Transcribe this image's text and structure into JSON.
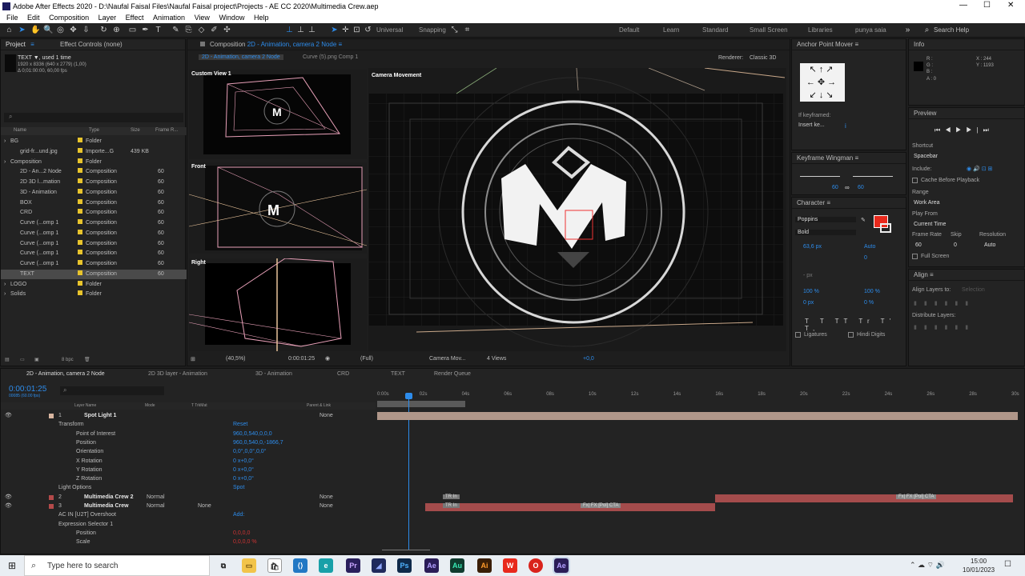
{
  "window": {
    "title": "Adobe After Effects 2020 - D:\\Naufal Faisal Files\\Naufal Faisal project\\Projects - AE CC 2020\\Multimedia Crew.aep"
  },
  "menu": [
    "File",
    "Edit",
    "Composition",
    "Layer",
    "Effect",
    "Animation",
    "View",
    "Window",
    "Help"
  ],
  "toolbar": {
    "universal": "Universal",
    "snapping": "Snapping"
  },
  "workspaces": [
    "Default",
    "Learn",
    "Standard",
    "Small Screen",
    "Libraries",
    "punya saia"
  ],
  "search_help": "Search Help",
  "project": {
    "tab_project": "Project",
    "tab_effects": "Effect Controls (none)",
    "item_name": "TEXT ▼, used 1 time",
    "item_dims": "1920 x 8336 (640 x 2779) (1,00)",
    "item_dur": "Δ 0;01:00:00, 60,00 fps",
    "cols": [
      "Name",
      "Type",
      "Size",
      "Frame R..."
    ],
    "items": [
      {
        "name": "BG",
        "type": "Folder",
        "size": "",
        "fr": "",
        "indent": 0,
        "color": "#e8c42c"
      },
      {
        "name": "grid-fr...und.jpg",
        "type": "Importe...G",
        "size": "439 KB",
        "fr": "",
        "indent": 1,
        "color": "#e8c42c"
      },
      {
        "name": "Composition",
        "type": "Folder",
        "size": "",
        "fr": "",
        "indent": 0,
        "color": "#e8c42c"
      },
      {
        "name": "2D - An...2 Node",
        "type": "Composition",
        "size": "",
        "fr": "60",
        "indent": 1,
        "color": "#e8c42c"
      },
      {
        "name": "2D 3D l...mation",
        "type": "Composition",
        "size": "",
        "fr": "60",
        "indent": 1,
        "color": "#e8c42c"
      },
      {
        "name": "3D - Animation",
        "type": "Composition",
        "size": "",
        "fr": "60",
        "indent": 1,
        "color": "#e8c42c"
      },
      {
        "name": "BOX",
        "type": "Composition",
        "size": "",
        "fr": "60",
        "indent": 1,
        "color": "#e8c42c"
      },
      {
        "name": "CRD",
        "type": "Composition",
        "size": "",
        "fr": "60",
        "indent": 1,
        "color": "#e8c42c"
      },
      {
        "name": "Curve (...omp 1",
        "type": "Composition",
        "size": "",
        "fr": "60",
        "indent": 1,
        "color": "#e8c42c"
      },
      {
        "name": "Curve (...omp 1",
        "type": "Composition",
        "size": "",
        "fr": "60",
        "indent": 1,
        "color": "#e8c42c"
      },
      {
        "name": "Curve (...omp 1",
        "type": "Composition",
        "size": "",
        "fr": "60",
        "indent": 1,
        "color": "#e8c42c"
      },
      {
        "name": "Curve (...omp 1",
        "type": "Composition",
        "size": "",
        "fr": "60",
        "indent": 1,
        "color": "#e8c42c"
      },
      {
        "name": "Curve (...omp 1",
        "type": "Composition",
        "size": "",
        "fr": "60",
        "indent": 1,
        "color": "#e8c42c"
      },
      {
        "name": "TEXT",
        "type": "Composition",
        "size": "",
        "fr": "60",
        "indent": 1,
        "color": "#e8c42c"
      },
      {
        "name": "LOGO",
        "type": "Folder",
        "size": "",
        "fr": "",
        "indent": 0,
        "color": "#e8c42c"
      },
      {
        "name": "Solids",
        "type": "Folder",
        "size": "",
        "fr": "",
        "indent": 0,
        "color": "#e8c42c"
      }
    ],
    "bpc": "8 bpc"
  },
  "comp": {
    "tab": "Composition",
    "tab_name": "2D - Animation, camera 2 Node",
    "sub1": "2D - Animation, camera 2 Node",
    "sub2": "Curve (5).png Comp 1",
    "renderer_label": "Renderer:",
    "renderer": "Classic 3D",
    "views": [
      "Custom View 1",
      "Front",
      "Right",
      "Camera Movement"
    ],
    "footer": {
      "zoom": "(40,5%)",
      "time": "0:00:01:25",
      "quality": "(Full)",
      "camera": "Camera Mov...",
      "views": "4 Views",
      "exposure": "+0,0"
    }
  },
  "anchor": {
    "title": "Anchor Point Mover",
    "if_kf": "If keyframed:",
    "insert": "Insert ke..."
  },
  "wingman": {
    "title": "Keyframe Wingman",
    "v1": "60",
    "v2": "60"
  },
  "character": {
    "title": "Character",
    "font": "Poppins",
    "style": "Bold",
    "size": "63,6 px",
    "leading": "Auto",
    "tracking": "0",
    "stroke": "- px",
    "vscale": "100 %",
    "hscale": "100 %",
    "baseline": "0 px",
    "tsume": "0 %",
    "ligatures": "Ligatures",
    "hindi": "Hindi Digits",
    "fill": "#e8291c"
  },
  "info": {
    "title": "Info",
    "r": "R :",
    "g": "G :",
    "b": "B :",
    "a": "A :  0",
    "x": "X : 244",
    "y": "Y : 1193"
  },
  "preview": {
    "title": "Preview",
    "shortcut_label": "Shortcut",
    "shortcut": "Spacebar",
    "include": "Include:",
    "cache": "Cache Before Playback",
    "range_label": "Range",
    "range": "Work Area",
    "play_from_label": "Play From",
    "play_from": "Current Time",
    "fr_label": "Frame Rate",
    "skip_label": "Skip",
    "res_label": "Resolution",
    "fr": "60",
    "skip": "0",
    "res": "Auto",
    "full": "Full Screen"
  },
  "align": {
    "title": "Align",
    "layers_to": "Align Layers to:",
    "selection": "Selection",
    "distribute": "Distribute Layers:"
  },
  "timeline": {
    "tabs": [
      "2D - Animation, camera 2 Node",
      "2D 3D layer - Animation",
      "3D - Animation",
      "CRD",
      "TEXT",
      "Render Queue"
    ],
    "time": "0:00:01:25",
    "frames": "00085 (60.00 fps)",
    "cols": [
      "Layer Name",
      "Mode",
      "T TrkMat",
      "Parent & Link"
    ],
    "ruler": [
      "0:00s",
      "02s",
      "04s",
      "06s",
      "08s",
      "10s",
      "12s",
      "14s",
      "16s",
      "18s",
      "20s",
      "22s",
      "24s",
      "26s",
      "28s",
      "30s"
    ],
    "rows": [
      {
        "num": "1",
        "name": "Spot Light 1",
        "kind": "layer",
        "val": "",
        "parent": "None",
        "color": "#d8b5a0"
      },
      {
        "name": "Transform",
        "kind": "group",
        "val": "Reset"
      },
      {
        "name": "Point of Interest",
        "kind": "prop",
        "val": "960,0,540,0,0,0"
      },
      {
        "name": "Position",
        "kind": "prop",
        "val": "960,0,540,0,-1866,7"
      },
      {
        "name": "Orientation",
        "kind": "prop",
        "val": "0,0°,0,0°,0,0°"
      },
      {
        "name": "X Rotation",
        "kind": "prop",
        "val": "0 x+0,0°"
      },
      {
        "name": "Y Rotation",
        "kind": "prop",
        "val": "0 x+0,0°"
      },
      {
        "name": "Z Rotation",
        "kind": "prop",
        "val": "0 x+0,0°"
      },
      {
        "name": "Light Options",
        "kind": "group",
        "val": "Spot"
      },
      {
        "num": "2",
        "name": "Multimedia Crew 2",
        "kind": "layer",
        "mode": "Normal",
        "parent": "None",
        "color": "#b44a4a"
      },
      {
        "num": "3",
        "name": "Multimedia Crew",
        "kind": "layer",
        "mode": "Normal",
        "trk": "None",
        "parent": "None",
        "color": "#b44a4a"
      },
      {
        "name": "AC IN [U2T] Overshoot",
        "kind": "group",
        "val": "Add:"
      },
      {
        "name": "Expression Selector 1",
        "kind": "group",
        "val": ""
      },
      {
        "name": "Position",
        "kind": "prop",
        "val": "0,0,0,0"
      },
      {
        "name": "Scale",
        "kind": "prop",
        "val": "0,0,0,0 %"
      }
    ],
    "bar_labels": {
      "b1": "TR In",
      "b2": "TR In",
      "b3": "Fx| FX [Pol] CTA",
      "b4": "Fx| FX [Pol] CTA"
    }
  },
  "taskbar": {
    "search": "Type here to search",
    "time": "15:00",
    "date": "10/01/2023",
    "apps": [
      {
        "t": "Pr",
        "c": "#2a1f5c"
      },
      {
        "t": "Ps",
        "c": "#0f2a4a"
      },
      {
        "t": "Ae",
        "c": "#2b1d57"
      },
      {
        "t": "Au",
        "c": "#0f3b2e"
      },
      {
        "t": "Ai",
        "c": "#3a1e06"
      }
    ]
  }
}
